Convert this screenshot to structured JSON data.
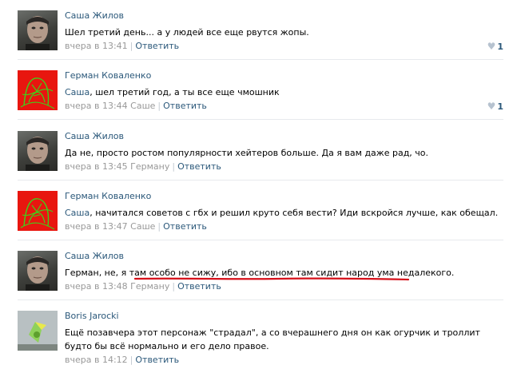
{
  "comments": [
    {
      "author": "Саша Жилов",
      "avatar": "man-photo-avatar",
      "mention": "",
      "text": "Шел третий день... а у людей все еще рвутся жопы.",
      "time": "вчера в 13:41",
      "addressee": "",
      "reply": "Ответить",
      "likes": "1",
      "like_icon": "heart-icon"
    },
    {
      "author": "Герман Коваленко",
      "avatar": "red-scribble-avatar",
      "mention": "Саша",
      "text": ", шел третий год, а ты все еще чмошник",
      "time": "вчера в 13:44",
      "addressee": "Саше",
      "reply": "Ответить",
      "likes": "1",
      "like_icon": "heart-icon"
    },
    {
      "author": "Саша Жилов",
      "avatar": "man-photo-avatar",
      "mention": "",
      "text": "Да не, просто ростом популярности хейтеров больше. Да я вам даже рад, чо.",
      "time": "вчера в 13:45",
      "addressee": "Герману",
      "reply": "Ответить",
      "likes": "",
      "like_icon": ""
    },
    {
      "author": "Герман Коваленко",
      "avatar": "red-scribble-avatar",
      "mention": "Саша",
      "text": ", начитался советов с гбх и решил круто себя вести? Иди вскройся лучше, как обещал.",
      "time": "вчера в 13:47",
      "addressee": "Саше",
      "reply": "Ответить",
      "likes": "",
      "like_icon": ""
    },
    {
      "author": "Саша Жилов",
      "avatar": "man-photo-avatar",
      "mention": "",
      "text": "Герман, не, я там особо не сижу, ибо в основном там сидит народ ума недалекого.",
      "time": "вчера в 13:48",
      "addressee": "Герману",
      "reply": "Ответить",
      "likes": "",
      "like_icon": ""
    },
    {
      "author": "Boris Jarocki",
      "avatar": "toy-figure-avatar",
      "mention": "",
      "text": "Ещё позавчера этот персонаж \"страдал\", а со вчерашнего дня он как огурчик и троллит\nбудто бы всё нормально и его дело правое.",
      "time": "вчера в 14:12",
      "addressee": "",
      "reply": "Ответить",
      "likes": "",
      "like_icon": ""
    }
  ],
  "colors": {
    "link": "#2b587a",
    "meta": "#999999",
    "underline": "#d6101a",
    "avatar_red": "#e8160f",
    "scribble_green": "#3fd11a"
  }
}
